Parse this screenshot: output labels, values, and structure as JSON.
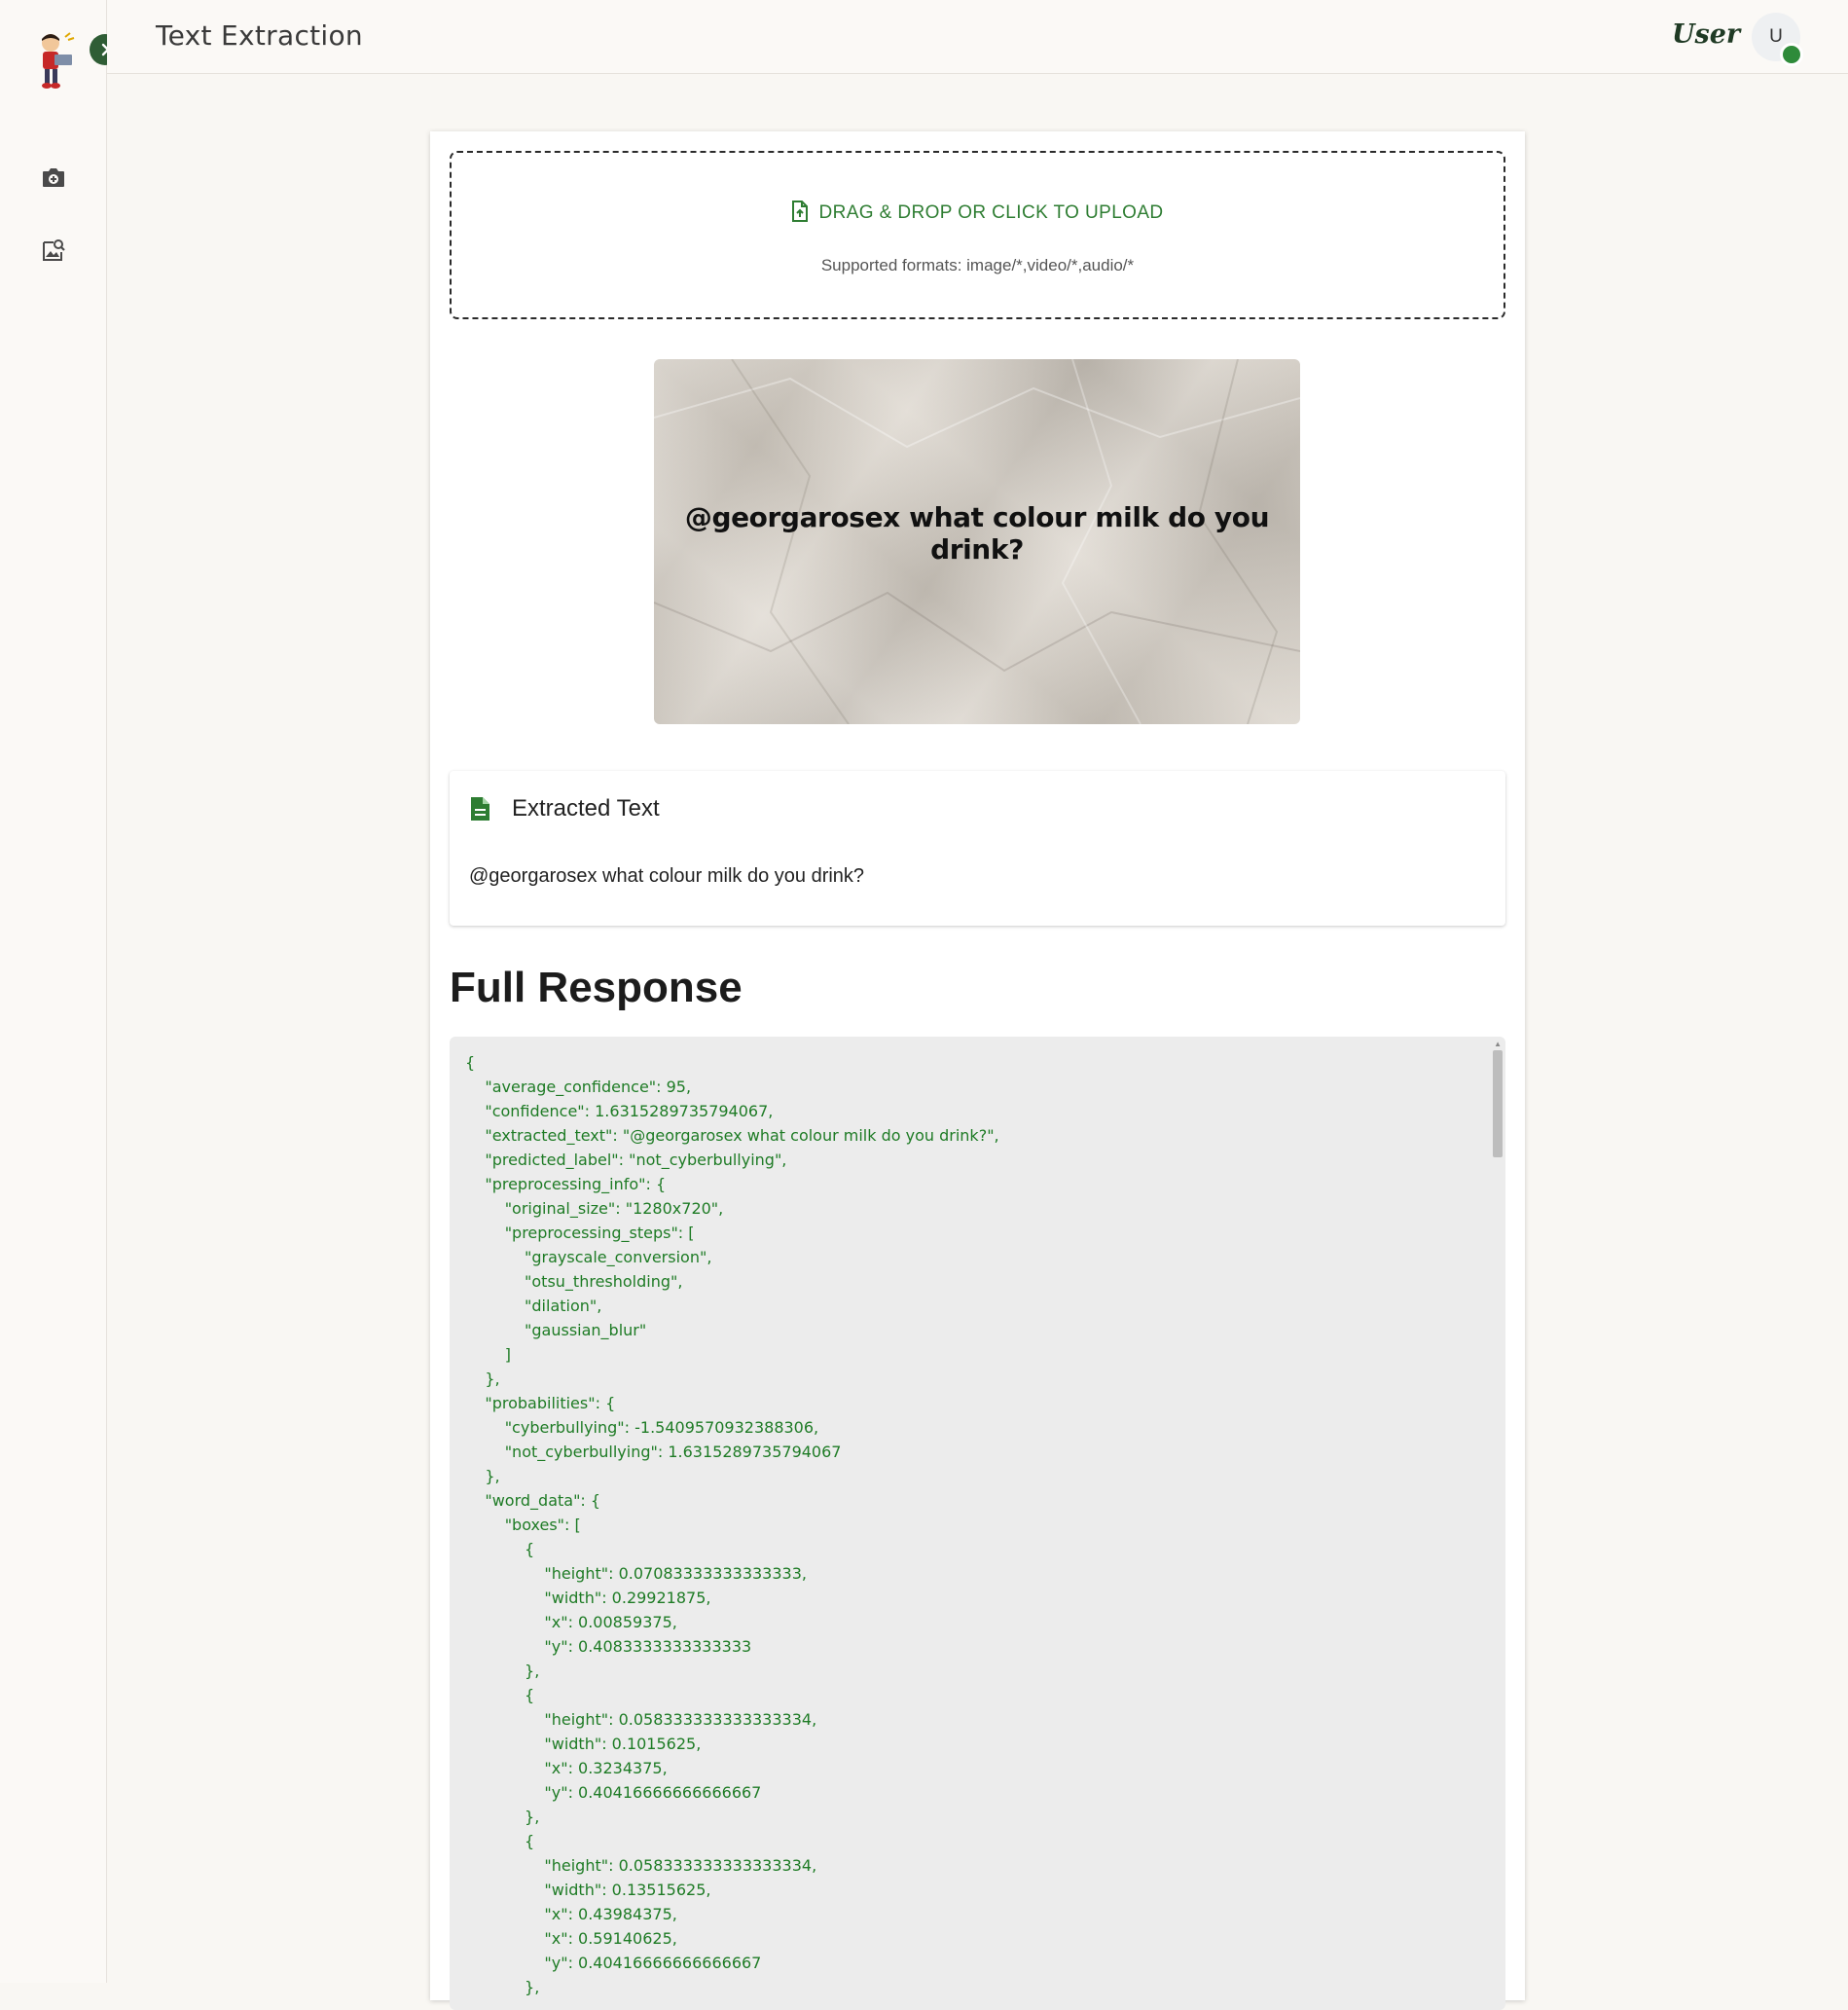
{
  "header": {
    "title": "Text Extraction",
    "user_name": "User",
    "avatar_initial": "U"
  },
  "sidebar": {
    "items": [
      {
        "icon": "camera-upload-icon"
      },
      {
        "icon": "image-search-icon"
      }
    ]
  },
  "upload": {
    "label": "DRAG & DROP OR CLICK TO UPLOAD",
    "formats": "Supported formats: image/*,video/*,audio/*"
  },
  "preview": {
    "image_text": "@georgarosex what colour milk do you drink?"
  },
  "extracted": {
    "title": "Extracted Text",
    "text": "@georgarosex what colour milk do you drink?"
  },
  "response": {
    "title": "Full Response",
    "json_text": "{\n\t\"average_confidence\": 95,\n\t\"confidence\": 1.6315289735794067,\n\t\"extracted_text\": \"@georgarosex what colour milk do you drink?\",\n\t\"predicted_label\": \"not_cyberbullying\",\n\t\"preprocessing_info\": {\n\t\t\"original_size\": \"1280x720\",\n\t\t\"preprocessing_steps\": [\n\t\t\t\"grayscale_conversion\",\n\t\t\t\"otsu_thresholding\",\n\t\t\t\"dilation\",\n\t\t\t\"gaussian_blur\"\n\t\t]\n\t},\n\t\"probabilities\": {\n\t\t\"cyberbullying\": -1.5409570932388306,\n\t\t\"not_cyberbullying\": 1.6315289735794067\n\t},\n\t\"word_data\": {\n\t\t\"boxes\": [\n\t\t\t{\n\t\t\t\t\"height\": 0.07083333333333333,\n\t\t\t\t\"width\": 0.29921875,\n\t\t\t\t\"x\": 0.00859375,\n\t\t\t\t\"y\": 0.4083333333333333\n\t\t\t},\n\t\t\t{\n\t\t\t\t\"height\": 0.058333333333333334,\n\t\t\t\t\"width\": 0.1015625,\n\t\t\t\t\"x\": 0.3234375,\n\t\t\t\t\"y\": 0.40416666666666667\n\t\t\t},\n\t\t\t{\n\t\t\t\t\"height\": 0.058333333333333334,\n\t\t\t\t\"width\": 0.13515625,\n\t\t\t\t\"x\": 0.43984375,\n\t\t\t\t\"x\": 0.59140625,\n\t\t\t\t\"y\": 0.40416666666666667\n\t\t\t},"
  },
  "colors": {
    "accent_green": "#2e7d32",
    "json_text": "#1e7b25",
    "sidebar_button": "#2f5d35"
  }
}
